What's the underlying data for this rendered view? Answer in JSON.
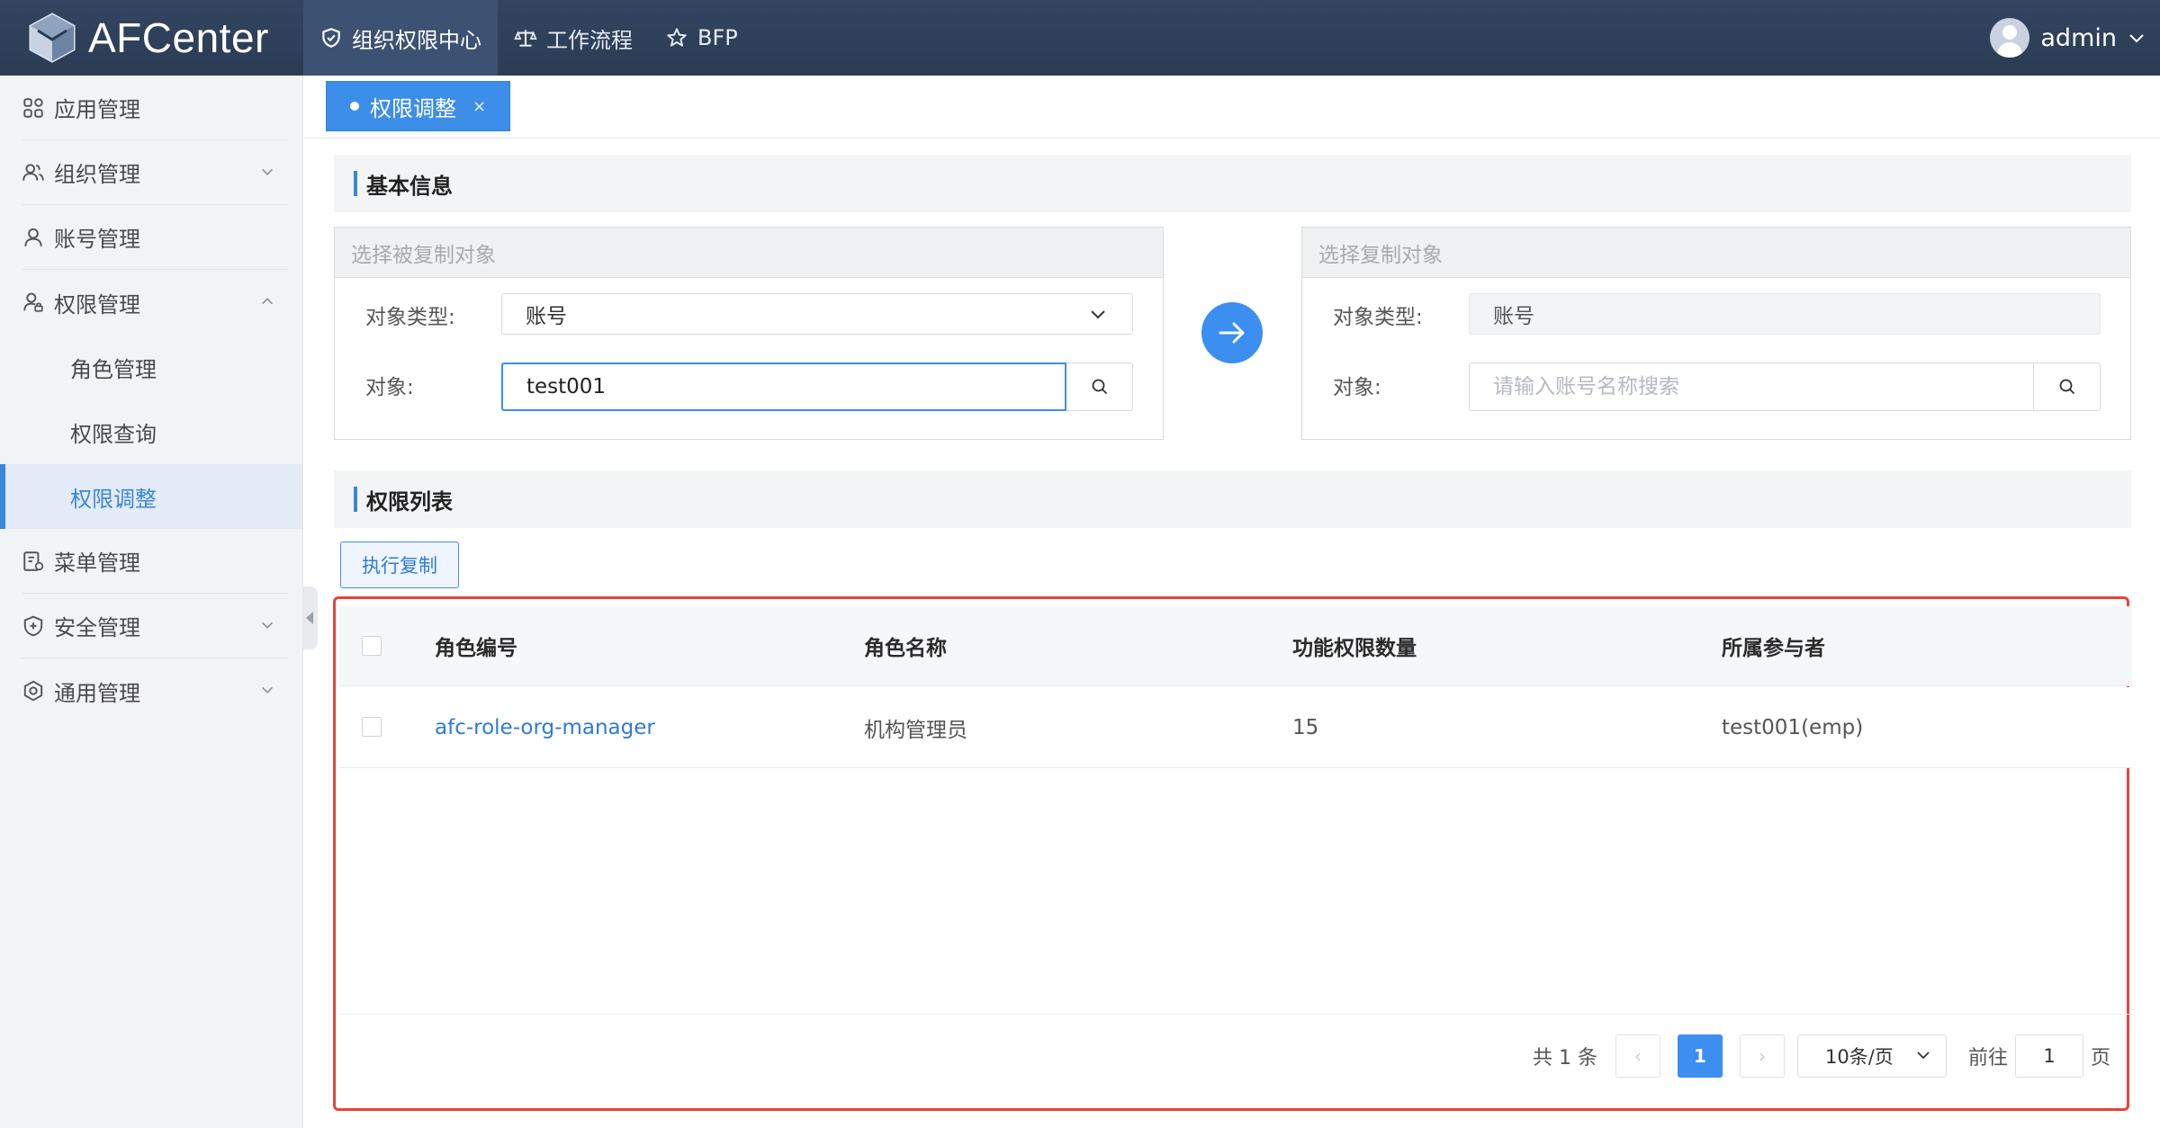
{
  "app": {
    "name": "AFCenter"
  },
  "nav": [
    {
      "label": "组织权限中心",
      "icon": "shield-icon",
      "active": true
    },
    {
      "label": "工作流程",
      "icon": "scale-icon",
      "active": false
    },
    {
      "label": "BFP",
      "icon": "star-icon",
      "active": false
    }
  ],
  "user": {
    "name": "admin"
  },
  "sidebar": {
    "items": [
      {
        "label": "应用管理",
        "icon": "grid-icon"
      },
      {
        "label": "组织管理",
        "icon": "users-icon"
      },
      {
        "label": "账号管理",
        "icon": "user-icon"
      },
      {
        "label": "权限管理",
        "icon": "user-lock-icon"
      },
      {
        "label": "菜单管理",
        "icon": "menu-doc-icon"
      },
      {
        "label": "安全管理",
        "icon": "shield-plus-icon"
      },
      {
        "label": "通用管理",
        "icon": "settings-icon"
      }
    ],
    "sub": [
      {
        "label": "角色管理"
      },
      {
        "label": "权限查询"
      },
      {
        "label": "权限调整",
        "active": true
      }
    ]
  },
  "tabs": [
    {
      "label": "权限调整",
      "close": "×"
    }
  ],
  "basic": {
    "title": "基本信息",
    "source": {
      "header": "选择被复制对象",
      "type_label": "对象类型:",
      "type_value": "账号",
      "object_label": "对象:",
      "object_value": "test001"
    },
    "target": {
      "header": "选择复制对象",
      "type_label": "对象类型:",
      "type_value": "账号",
      "object_label": "对象:",
      "object_placeholder": "请输入账号名称搜索"
    }
  },
  "perm": {
    "title": "权限列表",
    "exec_button": "执行复制",
    "columns": [
      "角色编号",
      "角色名称",
      "功能权限数量",
      "所属参与者"
    ],
    "rows": [
      {
        "code": "afc-role-org-manager",
        "name": "机构管理员",
        "count": "15",
        "owner": "test001(emp)"
      }
    ]
  },
  "pagination": {
    "total": "共 1 条",
    "prev": "‹",
    "next": "›",
    "current": "1",
    "page_size": "10条/页",
    "goto_label": "前往",
    "goto_value": "1",
    "page_unit": "页"
  },
  "colors": {
    "accent": "#3c8ef0",
    "header_bg": "#2b3c55",
    "highlight": "#e0463a"
  }
}
